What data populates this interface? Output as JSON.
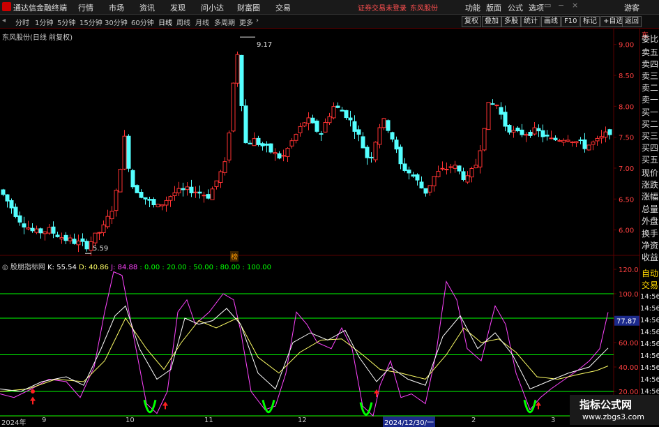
{
  "menubar": {
    "app_name": "通达信金融终端",
    "menus": [
      "行情",
      "市场",
      "资讯",
      "发现",
      "问小达",
      "财富圈",
      "交易"
    ],
    "notice": "证券交易未登录",
    "stock": "东风股份",
    "right_menus": [
      "功能",
      "版面",
      "公式",
      "选项"
    ],
    "user": "游客"
  },
  "tabbar": {
    "periods": [
      "分时",
      "1分钟",
      "5分钟",
      "15分钟",
      "30分钟",
      "60分钟",
      "日线",
      "周线",
      "月线",
      "多周期",
      "更多"
    ],
    "active": "日线",
    "buttons": [
      "复权",
      "叠加",
      "多股",
      "统计",
      "画线",
      "F10",
      "标记",
      "+自选",
      "返回"
    ]
  },
  "main_chart": {
    "caption": "东风股份(日线 前复权)",
    "high_label": "9.17",
    "low_label": "5.59",
    "marker": "榜",
    "y_ticks": [
      "9.00",
      "8.50",
      "8.00",
      "7.50",
      "7.00",
      "6.50",
      "6.00"
    ],
    "y_range": [
      5.6,
      9.2
    ]
  },
  "indicator": {
    "name": "股朋指标网",
    "values": [
      {
        "label": "K: 55.54",
        "color": "#ffffff"
      },
      {
        "label": "D: 40.86",
        "color": "#ffff66"
      },
      {
        "label": "J: 84.88",
        "color": "#ff44ff"
      },
      {
        "label": ": 0.00",
        "color": "#00ff00"
      },
      {
        "label": ": 20.00",
        "color": "#00ff00"
      },
      {
        "label": ": 50.00",
        "color": "#00ff00"
      },
      {
        "label": ": 80.00",
        "color": "#00ff00"
      },
      {
        "label": ": 100.00",
        "color": "#00ff00"
      }
    ],
    "y_ticks": [
      "120.0",
      "100.0",
      "80.00",
      "60.00",
      "40.00",
      "20.00"
    ],
    "y_range": [
      0,
      120
    ],
    "current": "77.87"
  },
  "sidebar": {
    "items": [
      "委比",
      "卖五",
      "卖四",
      "卖三",
      "卖二",
      "卖一",
      "买一",
      "买二",
      "买三",
      "买四",
      "买五",
      "现价",
      "涨跌",
      "涨幅",
      "总量",
      "外盘",
      "换手",
      "净资",
      "收益"
    ],
    "trade_items": [
      "自动",
      "交易"
    ],
    "times": [
      "14:56",
      "14:56",
      "14:56",
      "14:56",
      "14:56",
      "14:56",
      "14:56",
      "14:56",
      "14:56"
    ],
    "top": "东"
  },
  "x_axis": {
    "labels": [
      "2024年",
      "9",
      "10",
      "11",
      "2024/12/30/一",
      "12",
      "2",
      "3"
    ]
  },
  "watermark": {
    "title": "指标公式网",
    "url": "www.zbgs3.com"
  },
  "colors": {
    "up": "#ff3232",
    "down": "#54ffff",
    "k": "#ffffff",
    "d": "#ffff66",
    "j": "#ff44ff",
    "ref": "#00ff00",
    "frame": "#5a0000"
  }
}
